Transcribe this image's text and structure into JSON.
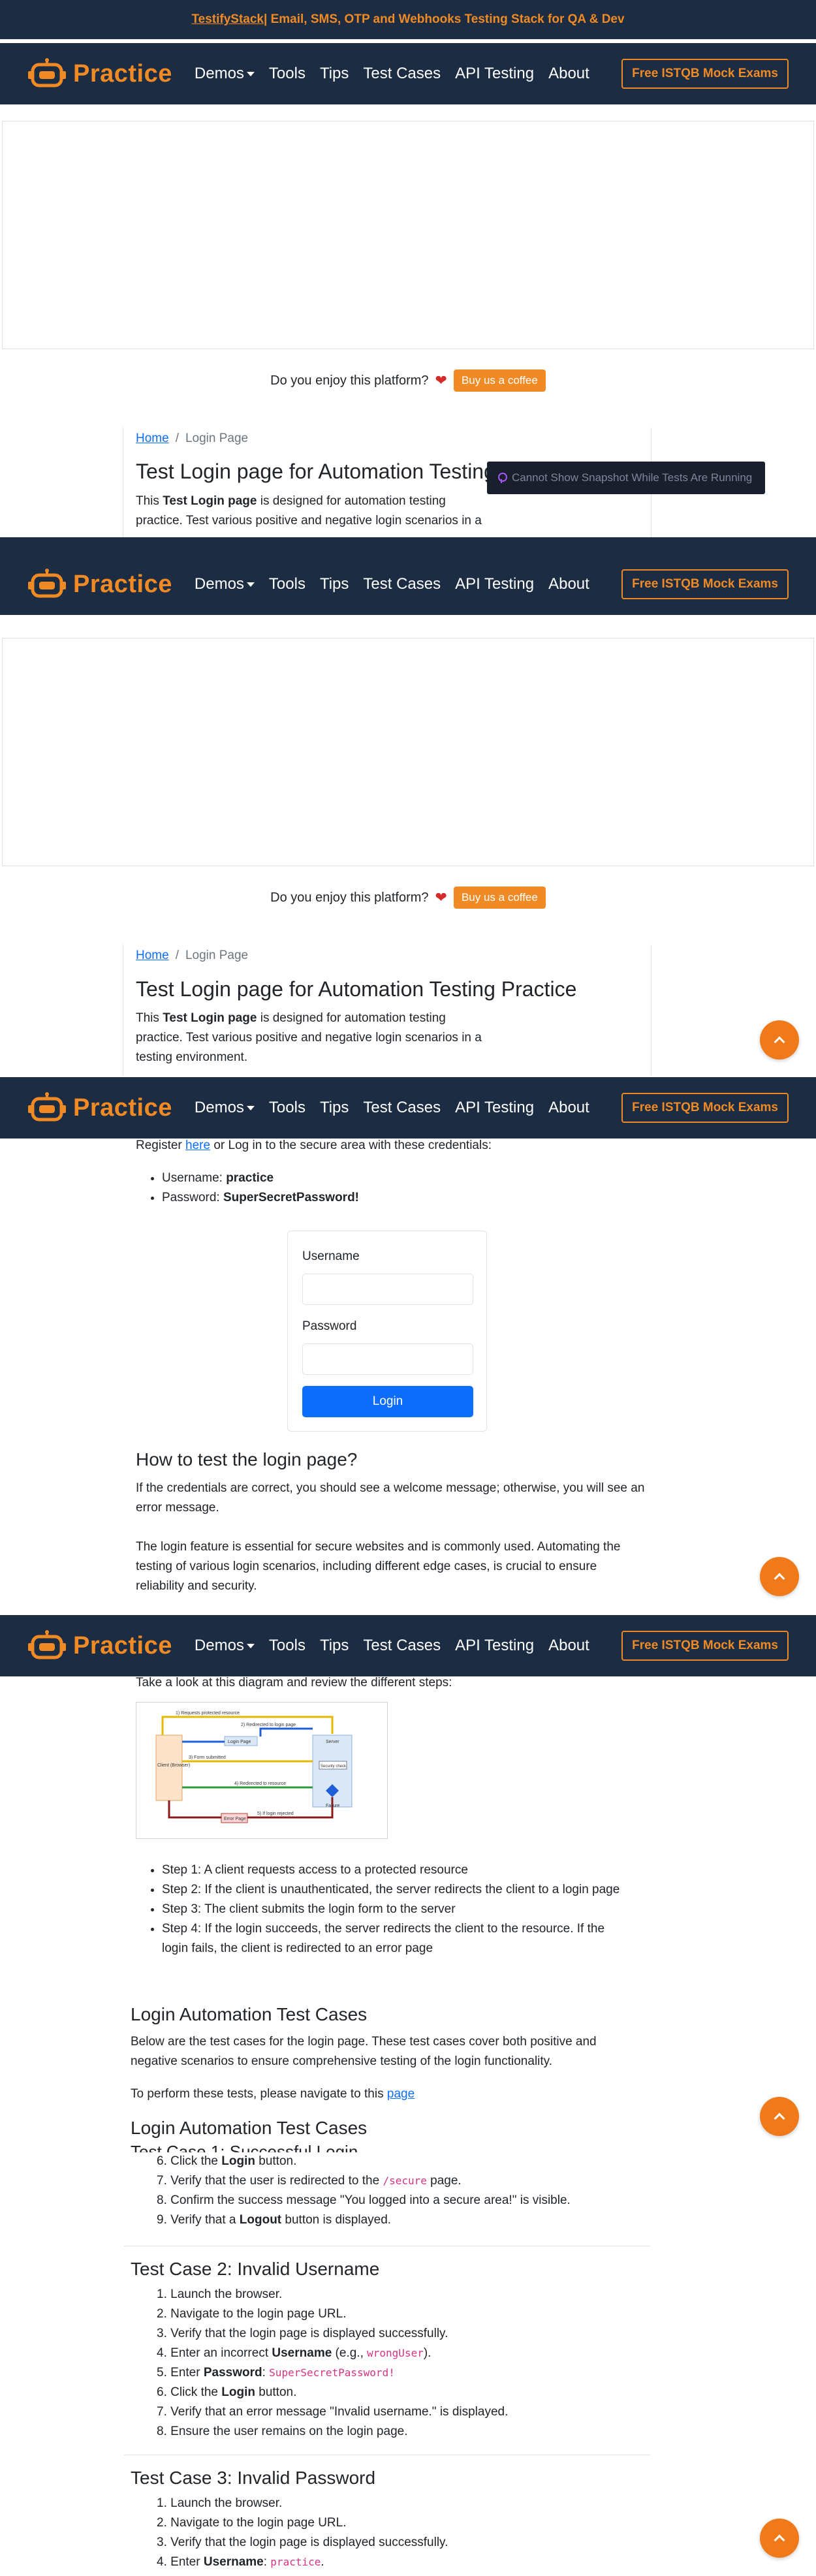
{
  "promo": {
    "brand": "TestifyStack",
    "rest": " | Email, SMS, OTP and Webhooks Testing Stack for QA & Dev"
  },
  "nav": {
    "logo_text": "Practice",
    "links": [
      "Demos",
      "Tools",
      "Tips",
      "Test Cases",
      "API Testing",
      "About"
    ],
    "exam_button": "Free ISTQB Mock Exams"
  },
  "coffee": {
    "question": "Do you enjoy this platform?",
    "button": "Buy us a coffee"
  },
  "breadcrumb": {
    "home": "Home",
    "current": "Login Page"
  },
  "page": {
    "title": "Test Login page for Automation Testing Practice",
    "title_truncated": "Test Login page for Automation Testing",
    "intro_pre": "This ",
    "intro_bold": "Test Login page",
    "intro_post": " is designed for automation testing",
    "intro_line2": "practice. Test various positive and negative login scenarios in a",
    "intro_line3": "testing environment."
  },
  "toast": {
    "text": "Cannot Show Snapshot While Tests Are Running"
  },
  "credentials": {
    "lead_pre": "Register ",
    "lead_link": "here",
    "lead_post": " or Log in to the secure area with these credentials:",
    "username_label": "Username: ",
    "username_value": "practice",
    "password_label": "Password: ",
    "password_value": "SuperSecretPassword!"
  },
  "login_form": {
    "username_label": "Username",
    "password_label": "Password",
    "submit": "Login"
  },
  "how_to": {
    "heading": "How to test the login page?",
    "p1": "If the credentials are correct, you should see a welcome message; otherwise, you will see an error message.",
    "p2": "The login feature is essential for secure websites and is commonly used. Automating the testing of various login scenarios, including different edge cases, is crucial to ensure reliability and security."
  },
  "diagram": {
    "intro": "Take a look at this diagram and review the different steps:",
    "labels": [
      "1) Requests protected resource",
      "2) Redirected to login page",
      "Login Page",
      "3) Form submitted",
      "Server",
      "Client (Browser)",
      "Security check",
      "4) Redirected to resource",
      "Failure",
      "Error Page",
      "5) If login rejected"
    ]
  },
  "steps": [
    "Step 1: A client requests access to a protected resource",
    "Step 2: If the client is unauthenticated, the server redirects the client to a login page",
    "Step 3: The client submits the login form to the server",
    "Step 4: If the login succeeds, the server redirects the client to the resource. If the login fails, the client is redirected to an error page"
  ],
  "automation": {
    "heading": "Login Automation Test Cases",
    "p1": "Below are the test cases for the login page. These test cases cover both positive and negative scenarios to ensure comprehensive testing of the login functionality.",
    "p2_pre": "To perform these tests, please navigate to this ",
    "p2_link": "page",
    "heading2": "Login Automation Test Cases",
    "tc1_heading": "Test Case 1: Successful Login"
  },
  "tc1_tail": [
    {
      "n": "6.",
      "pre": "Click the ",
      "bold": "Login",
      "post": " button."
    },
    {
      "n": "7.",
      "pre": "Verify that the user is redirected to the ",
      "code": "/secure",
      "post": " page."
    },
    {
      "n": "8.",
      "pre": "Confirm the success message \"You logged into a secure area!\" is visible."
    },
    {
      "n": "9.",
      "pre": "Verify that a ",
      "bold": "Logout",
      "post": " button is displayed."
    }
  ],
  "tc2": {
    "heading": "Test Case 2: Invalid Username",
    "steps": [
      {
        "n": "1.",
        "pre": "Launch the browser."
      },
      {
        "n": "2.",
        "pre": "Navigate to the login page URL."
      },
      {
        "n": "3.",
        "pre": "Verify that the login page is displayed successfully."
      },
      {
        "n": "4.",
        "pre": "Enter an incorrect ",
        "bold": "Username",
        "post": " (e.g., ",
        "code": "wrongUser",
        "post2": ")."
      },
      {
        "n": "5.",
        "pre": "Enter ",
        "bold": "Password",
        "post": ": ",
        "code": "SuperSecretPassword!"
      },
      {
        "n": "6.",
        "pre": "Click the ",
        "bold": "Login",
        "post": " button."
      },
      {
        "n": "7.",
        "pre": "Verify that an error message \"Invalid username.\" is displayed."
      },
      {
        "n": "8.",
        "pre": "Ensure the user remains on the login page."
      }
    ]
  },
  "tc3": {
    "heading": "Test Case 3: Invalid Password",
    "steps": [
      {
        "n": "1.",
        "pre": "Launch the browser."
      },
      {
        "n": "2.",
        "pre": "Navigate to the login page URL."
      },
      {
        "n": "3.",
        "pre": "Verify that the login page is displayed successfully."
      },
      {
        "n": "4.",
        "pre": "Enter ",
        "bold": "Username",
        "post": ": ",
        "code": "practice",
        "post2": "."
      }
    ]
  }
}
